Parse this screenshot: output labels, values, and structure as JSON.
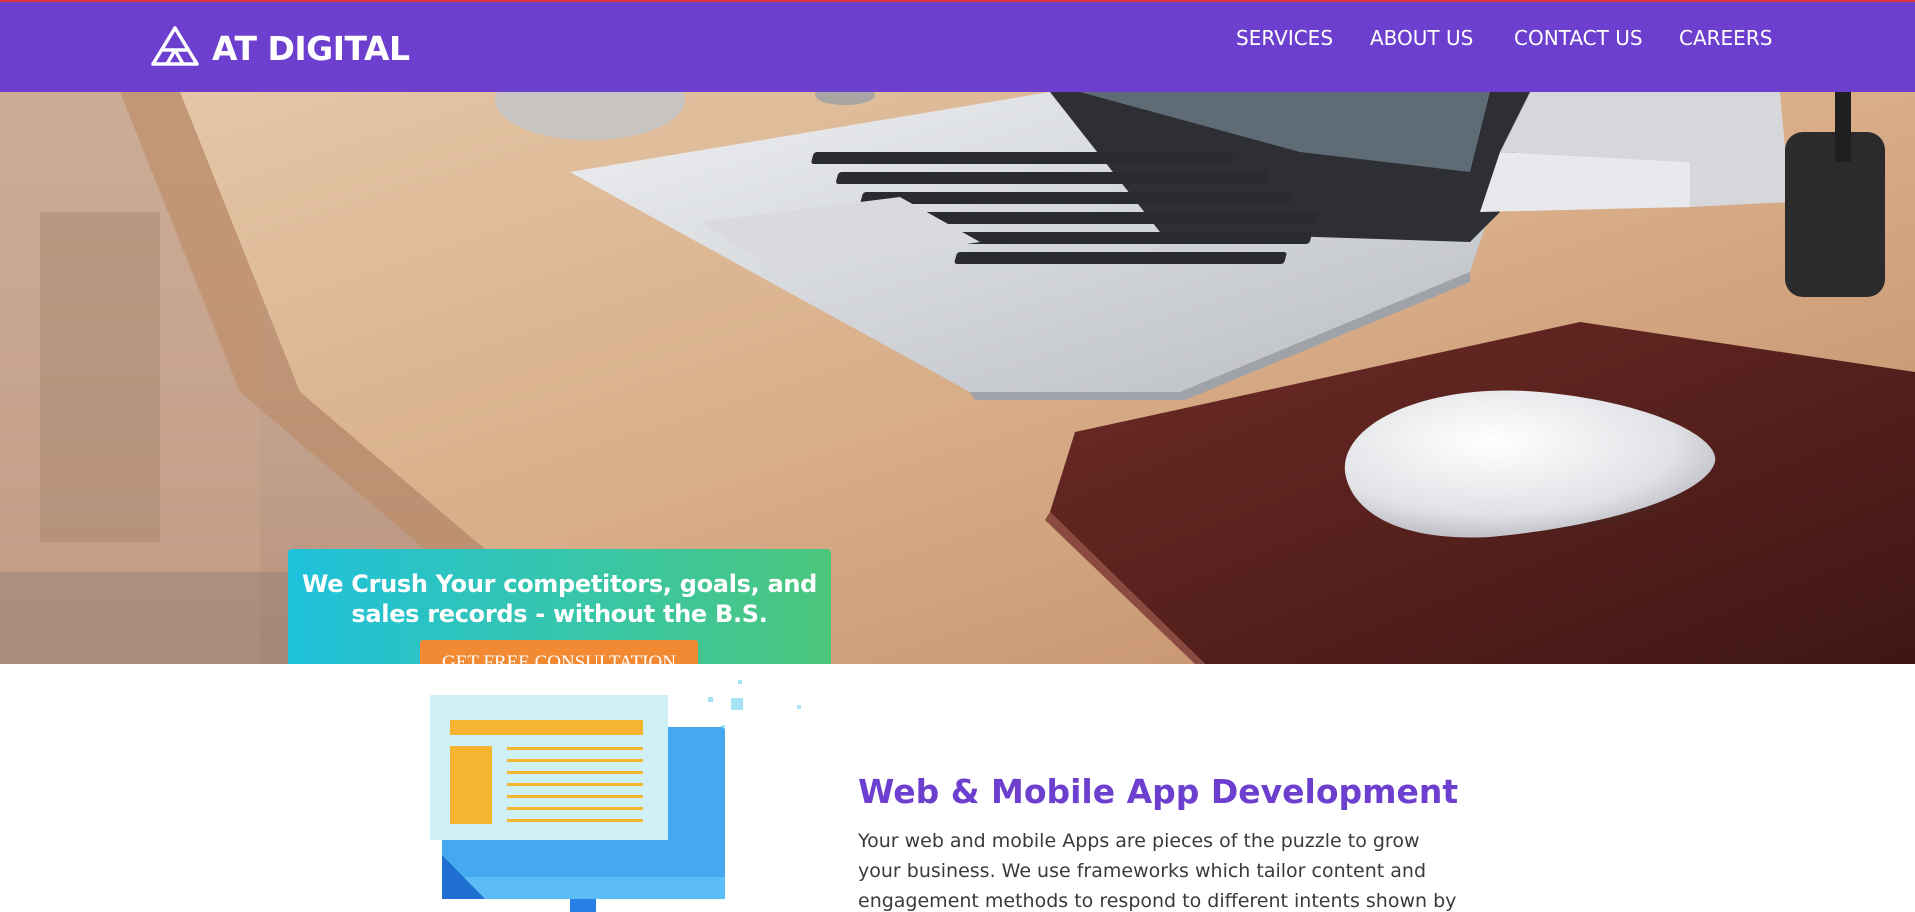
{
  "brand": {
    "name": "AT DIGITAL",
    "logo_icon": "triangle-a-logo-icon",
    "color": "#6c3fcf"
  },
  "nav": {
    "items": [
      {
        "label": "SERVICES"
      },
      {
        "label": "ABOUT US"
      },
      {
        "label": "CONTACT US"
      },
      {
        "label": "CAREERS"
      }
    ]
  },
  "hero": {
    "image": "desk-laptop-mouse-photo",
    "headline": "We Crush Your competitors, goals, and sales records - without the B.S.",
    "cta_label": "GET FREE CONSULTATION",
    "cta_color": "#f28a33"
  },
  "service": {
    "icon": "web-app-monitor-illustration",
    "title": "Web & Mobile App Development",
    "description": "Your web and mobile Apps are pieces of the puzzle to grow your business. We use frameworks which tailor content and engagement methods to respond to different intents shown by your potential"
  }
}
